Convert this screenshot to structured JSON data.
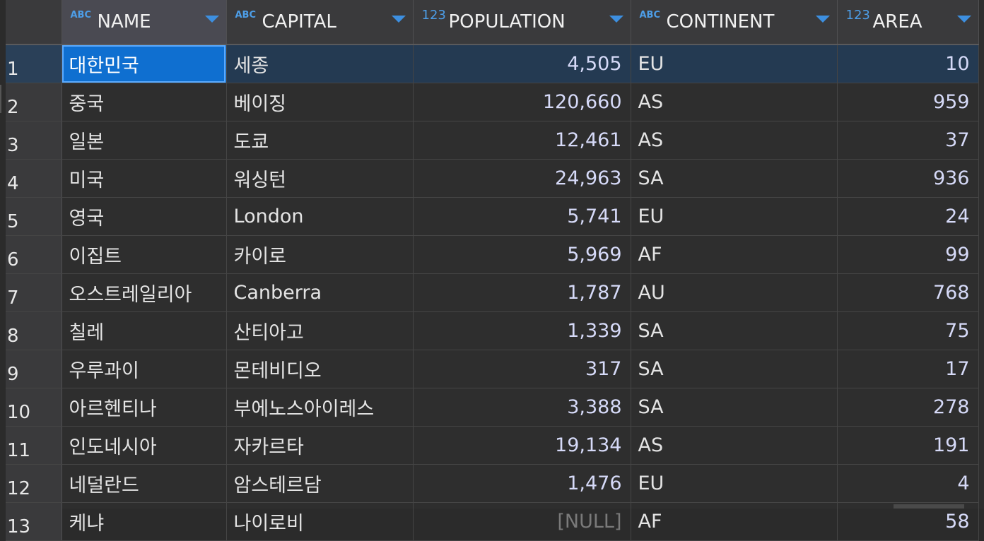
{
  "columns": [
    {
      "type": "ABC",
      "name": "NAME"
    },
    {
      "type": "ABC",
      "name": "CAPITAL"
    },
    {
      "type": "123",
      "name": "POPULATION"
    },
    {
      "type": "ABC",
      "name": "CONTINENT"
    },
    {
      "type": "123",
      "name": "AREA"
    }
  ],
  "rows": [
    {
      "n": "1",
      "name": "대한민국",
      "capital": "세종",
      "population": "4,505",
      "continent": "EU",
      "area": "10"
    },
    {
      "n": "2",
      "name": "중국",
      "capital": "베이징",
      "population": "120,660",
      "continent": "AS",
      "area": "959"
    },
    {
      "n": "3",
      "name": "일본",
      "capital": "도쿄",
      "population": "12,461",
      "continent": "AS",
      "area": "37"
    },
    {
      "n": "4",
      "name": "미국",
      "capital": "워싱턴",
      "population": "24,963",
      "continent": "SA",
      "area": "936"
    },
    {
      "n": "5",
      "name": "영국",
      "capital": "London",
      "population": "5,741",
      "continent": "EU",
      "area": "24"
    },
    {
      "n": "6",
      "name": "이집트",
      "capital": "카이로",
      "population": "5,969",
      "continent": "AF",
      "area": "99"
    },
    {
      "n": "7",
      "name": "오스트레일리아",
      "capital": "Canberra",
      "population": "1,787",
      "continent": "AU",
      "area": "768"
    },
    {
      "n": "8",
      "name": "칠레",
      "capital": "산티아고",
      "population": "1,339",
      "continent": "SA",
      "area": "75"
    },
    {
      "n": "9",
      "name": "우루과이",
      "capital": "몬테비디오",
      "population": "317",
      "continent": "SA",
      "area": "17"
    },
    {
      "n": "10",
      "name": "아르헨티나",
      "capital": "부에노스아이레스",
      "population": "3,388",
      "continent": "SA",
      "area": "278"
    },
    {
      "n": "11",
      "name": "인도네시아",
      "capital": "자카르타",
      "population": "19,134",
      "continent": "AS",
      "area": "191"
    },
    {
      "n": "12",
      "name": "네덜란드",
      "capital": "암스테르담",
      "population": "1,476",
      "continent": "EU",
      "area": "4"
    },
    {
      "n": "13",
      "name": "케냐",
      "capital": "나이로비",
      "population": "[NULL]",
      "continent": "AF",
      "area": "58"
    }
  ],
  "selected_row": "1",
  "colors": {
    "accent": "#0f6fd0",
    "selected_row_bg": "#243a52",
    "type_icon": "#4d9ee8"
  }
}
